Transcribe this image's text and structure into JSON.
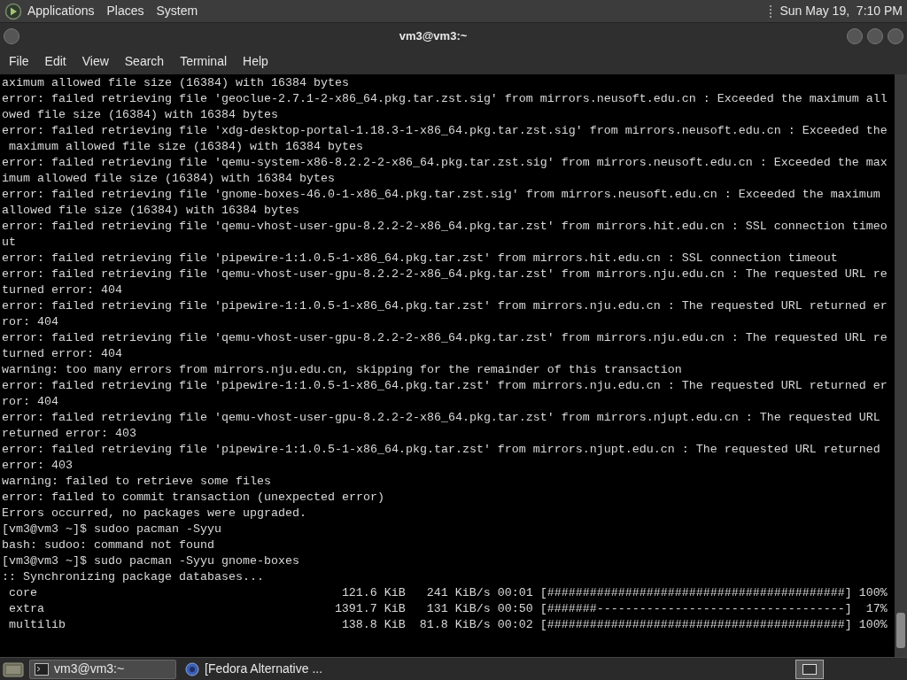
{
  "top_panel": {
    "menus": [
      "Applications",
      "Places",
      "System"
    ],
    "clock": "Sun May 19,  7:10 PM"
  },
  "window": {
    "title": "vm3@vm3:~"
  },
  "menu_bar": [
    "File",
    "Edit",
    "View",
    "Search",
    "Terminal",
    "Help"
  ],
  "terminal": {
    "lines": [
      "aximum allowed file size (16384) with 16384 bytes",
      "error: failed retrieving file 'geoclue-2.7.1-2-x86_64.pkg.tar.zst.sig' from mirrors.neusoft.edu.cn : Exceeded the maximum all",
      "owed file size (16384) with 16384 bytes",
      "error: failed retrieving file 'xdg-desktop-portal-1.18.3-1-x86_64.pkg.tar.zst.sig' from mirrors.neusoft.edu.cn : Exceeded the",
      " maximum allowed file size (16384) with 16384 bytes",
      "error: failed retrieving file 'qemu-system-x86-8.2.2-2-x86_64.pkg.tar.zst.sig' from mirrors.neusoft.edu.cn : Exceeded the max",
      "imum allowed file size (16384) with 16384 bytes",
      "error: failed retrieving file 'gnome-boxes-46.0-1-x86_64.pkg.tar.zst.sig' from mirrors.neusoft.edu.cn : Exceeded the maximum",
      "allowed file size (16384) with 16384 bytes",
      "error: failed retrieving file 'qemu-vhost-user-gpu-8.2.2-2-x86_64.pkg.tar.zst' from mirrors.hit.edu.cn : SSL connection timeo",
      "ut",
      "error: failed retrieving file 'pipewire-1:1.0.5-1-x86_64.pkg.tar.zst' from mirrors.hit.edu.cn : SSL connection timeout",
      "error: failed retrieving file 'qemu-vhost-user-gpu-8.2.2-2-x86_64.pkg.tar.zst' from mirrors.nju.edu.cn : The requested URL re",
      "turned error: 404",
      "error: failed retrieving file 'pipewire-1:1.0.5-1-x86_64.pkg.tar.zst' from mirrors.nju.edu.cn : The requested URL returned er",
      "ror: 404",
      "error: failed retrieving file 'qemu-vhost-user-gpu-8.2.2-2-x86_64.pkg.tar.zst' from mirrors.nju.edu.cn : The requested URL re",
      "turned error: 404",
      "warning: too many errors from mirrors.nju.edu.cn, skipping for the remainder of this transaction",
      "error: failed retrieving file 'pipewire-1:1.0.5-1-x86_64.pkg.tar.zst' from mirrors.nju.edu.cn : The requested URL returned er",
      "ror: 404",
      "error: failed retrieving file 'qemu-vhost-user-gpu-8.2.2-2-x86_64.pkg.tar.zst' from mirrors.njupt.edu.cn : The requested URL",
      "returned error: 403",
      "error: failed retrieving file 'pipewire-1:1.0.5-1-x86_64.pkg.tar.zst' from mirrors.njupt.edu.cn : The requested URL returned",
      "error: 403",
      "warning: failed to retrieve some files",
      "error: failed to commit transaction (unexpected error)",
      "Errors occurred, no packages were upgraded.",
      "[vm3@vm3 ~]$ sudoo pacman -Syyu",
      "bash: sudoo: command not found",
      "[vm3@vm3 ~]$ sudo pacman -Syyu gnome-boxes",
      ":: Synchronizing package databases..."
    ],
    "progress": [
      {
        "name": "core",
        "size": "121.6 KiB",
        "rate": "241 KiB/s",
        "eta": "00:01",
        "bar": "[##########################################]",
        "percent": "100%"
      },
      {
        "name": "extra",
        "size": "1391.7 KiB",
        "rate": "131 KiB/s",
        "eta": "00:50",
        "bar": "[#######-----------------------------------]",
        "percent": "17%"
      },
      {
        "name": "multilib",
        "size": "138.8 KiB",
        "rate": "81.8 KiB/s",
        "eta": "00:02",
        "bar": "[##########################################]",
        "percent": "100%"
      }
    ]
  },
  "taskbar": {
    "tasks": [
      {
        "label": "vm3@vm3:~",
        "kind": "terminal",
        "selected": true
      },
      {
        "label": "[Fedora Alternative ...",
        "kind": "browser",
        "selected": false
      }
    ]
  }
}
